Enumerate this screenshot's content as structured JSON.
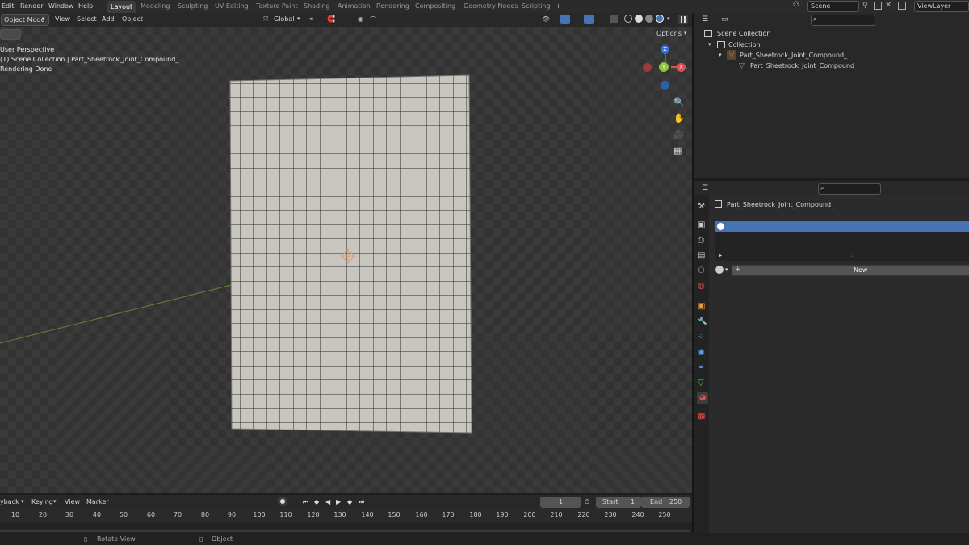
{
  "menu": {
    "items": [
      "Edit",
      "Render",
      "Window",
      "Help"
    ]
  },
  "workspaces": {
    "active": "Layout",
    "tabs": [
      "Modeling",
      "Sculpting",
      "UV Editing",
      "Texture Paint",
      "Shading",
      "Animation",
      "Rendering",
      "Compositing",
      "Geometry Nodes",
      "Scripting"
    ],
    "add_label": "+"
  },
  "top_right": {
    "scene": "Scene",
    "view_layer": "ViewLayer"
  },
  "viewport_header": {
    "mode": "Object Mode",
    "view": "View",
    "select": "Select",
    "add": "Add",
    "object": "Object",
    "transform": "Global",
    "options": "Options"
  },
  "viewport": {
    "perspective": "User Perspective",
    "collection_info": "(1) Scene Collection | Part_Sheetrock_Joint_Compound_",
    "status": "Rendering Done"
  },
  "gizmo": {
    "z": "Z",
    "x": "X",
    "y": "Y"
  },
  "outliner": {
    "scene_collection": "Scene Collection",
    "collection": "Collection",
    "object": "Part_Sheetrock_Joint_Compound_",
    "mesh": "Part_Sheetrock_Joint_Compound_"
  },
  "properties": {
    "object_name": "Part_Sheetrock_Joint_Compound_",
    "slot_count": "::",
    "new_button": "New"
  },
  "timeline": {
    "playback": "Playback",
    "keying": "Keying",
    "view": "View",
    "marker": "Marker",
    "current_frame": "1",
    "start_label": "Start",
    "start_value": "1",
    "end_label": "End",
    "end_value": "250",
    "ticks": [
      "10",
      "20",
      "30",
      "40",
      "50",
      "60",
      "70",
      "80",
      "90",
      "100",
      "110",
      "120",
      "130",
      "140",
      "150",
      "160",
      "170",
      "180",
      "190",
      "200",
      "210",
      "220",
      "230",
      "240",
      "250"
    ]
  },
  "statusbar": {
    "rotate": "Rotate View",
    "object": "Object"
  },
  "colors": {
    "accent_blue": "#4772b3",
    "x_axis": "#e24c4c",
    "y_axis": "#8cc63f",
    "z_axis": "#2f6fd6",
    "mesh_face": "#c9c5bf",
    "object_orange": "#e59a3c",
    "mesh_green": "#5fbf5f"
  }
}
